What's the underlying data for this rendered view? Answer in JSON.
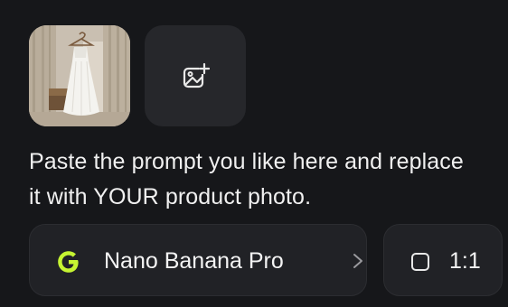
{
  "reference_image": {
    "icon": "product-photo-thumbnail"
  },
  "add_image": {
    "icon": "add-image-icon"
  },
  "prompt": {
    "text": "Paste the prompt you like here and replace it with YOUR product photo."
  },
  "model": {
    "label": "Nano Banana Pro",
    "icon": "google-g-logo",
    "accent": "#c6f432"
  },
  "aspect_ratio": {
    "label": "1:1",
    "icon": "square-icon"
  }
}
